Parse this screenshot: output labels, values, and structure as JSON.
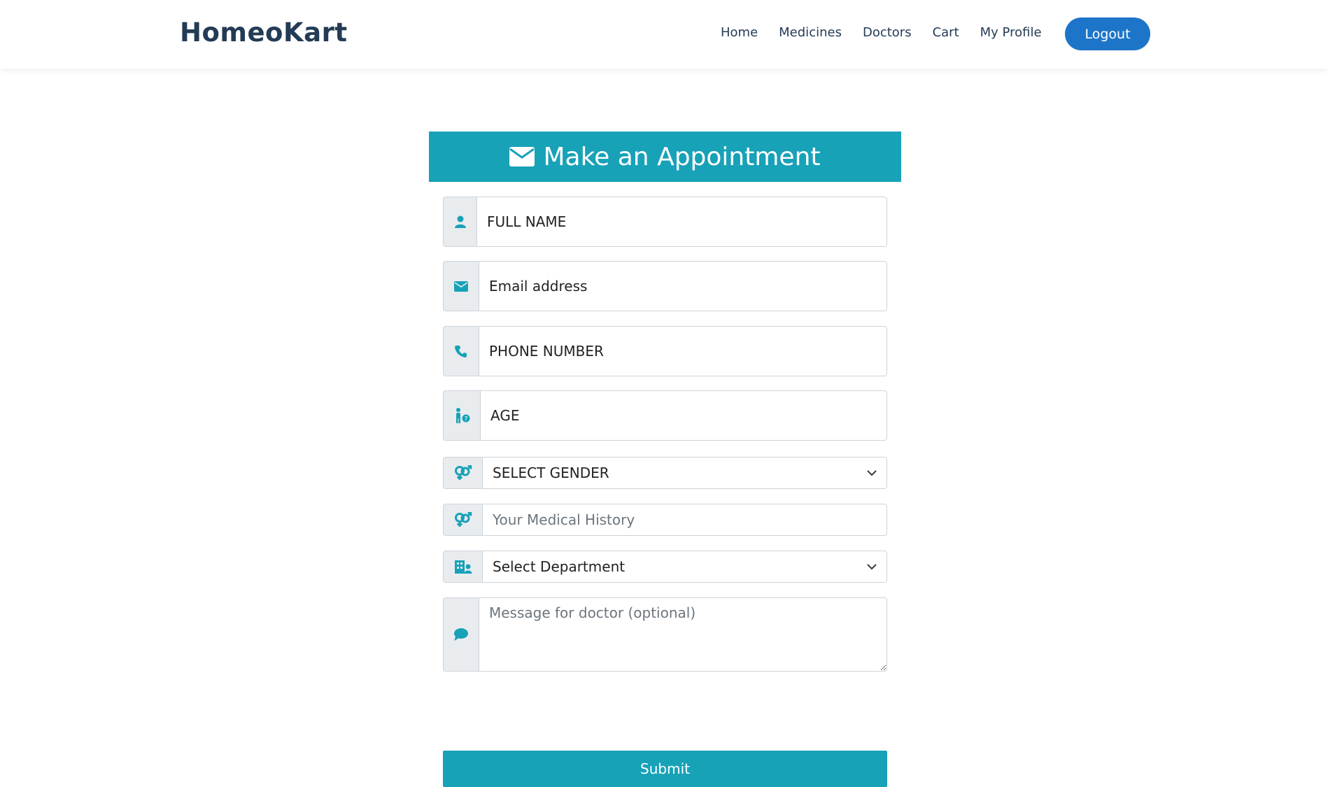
{
  "brand": "HomeoKart",
  "nav": {
    "home": "Home",
    "medicines": "Medicines",
    "doctors": "Doctors",
    "cart": "Cart",
    "profile": "My Profile",
    "logout": "Logout"
  },
  "form": {
    "title": "Make an Appointment",
    "full_name": "FULL NAME",
    "email": "Email address",
    "phone": "PHONE NUMBER",
    "age": "AGE",
    "gender_selected": "SELECT GENDER",
    "medical_history_placeholder": "Your Medical History",
    "department_selected": "Select Department",
    "message_placeholder": "Message for doctor (optional)",
    "submit": "Submit"
  },
  "icons": {
    "full_name": "user-icon",
    "email": "envelope-icon",
    "phone": "phone-icon",
    "age": "child-icon",
    "gender": "venus-mars-icon",
    "medical_history": "venus-mars-icon",
    "department": "hospital-user-icon",
    "message": "comment-icon"
  },
  "colors": {
    "accent": "#17a2b8",
    "brand": "#243b55",
    "logout": "#1d75c9"
  }
}
